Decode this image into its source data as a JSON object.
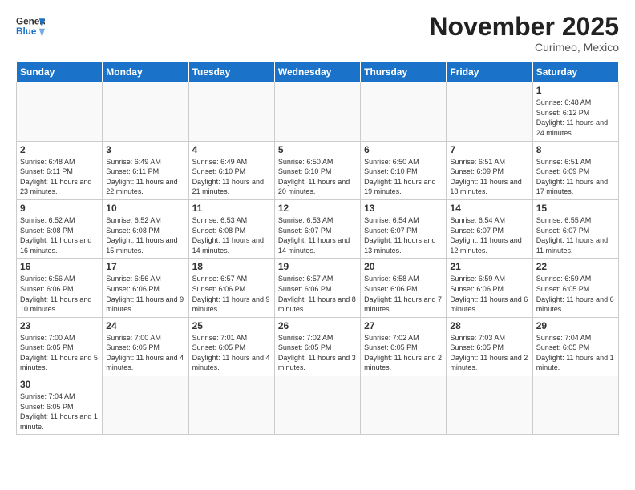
{
  "header": {
    "logo_general": "General",
    "logo_blue": "Blue",
    "month": "November 2025",
    "location": "Curimeo, Mexico"
  },
  "days_of_week": [
    "Sunday",
    "Monday",
    "Tuesday",
    "Wednesday",
    "Thursday",
    "Friday",
    "Saturday"
  ],
  "weeks": [
    [
      {
        "day": "",
        "info": ""
      },
      {
        "day": "",
        "info": ""
      },
      {
        "day": "",
        "info": ""
      },
      {
        "day": "",
        "info": ""
      },
      {
        "day": "",
        "info": ""
      },
      {
        "day": "",
        "info": ""
      },
      {
        "day": "1",
        "info": "Sunrise: 6:48 AM\nSunset: 6:12 PM\nDaylight: 11 hours and 24 minutes."
      }
    ],
    [
      {
        "day": "2",
        "info": "Sunrise: 6:48 AM\nSunset: 6:11 PM\nDaylight: 11 hours and 23 minutes."
      },
      {
        "day": "3",
        "info": "Sunrise: 6:49 AM\nSunset: 6:11 PM\nDaylight: 11 hours and 22 minutes."
      },
      {
        "day": "4",
        "info": "Sunrise: 6:49 AM\nSunset: 6:10 PM\nDaylight: 11 hours and 21 minutes."
      },
      {
        "day": "5",
        "info": "Sunrise: 6:50 AM\nSunset: 6:10 PM\nDaylight: 11 hours and 20 minutes."
      },
      {
        "day": "6",
        "info": "Sunrise: 6:50 AM\nSunset: 6:10 PM\nDaylight: 11 hours and 19 minutes."
      },
      {
        "day": "7",
        "info": "Sunrise: 6:51 AM\nSunset: 6:09 PM\nDaylight: 11 hours and 18 minutes."
      },
      {
        "day": "8",
        "info": "Sunrise: 6:51 AM\nSunset: 6:09 PM\nDaylight: 11 hours and 17 minutes."
      }
    ],
    [
      {
        "day": "9",
        "info": "Sunrise: 6:52 AM\nSunset: 6:08 PM\nDaylight: 11 hours and 16 minutes."
      },
      {
        "day": "10",
        "info": "Sunrise: 6:52 AM\nSunset: 6:08 PM\nDaylight: 11 hours and 15 minutes."
      },
      {
        "day": "11",
        "info": "Sunrise: 6:53 AM\nSunset: 6:08 PM\nDaylight: 11 hours and 14 minutes."
      },
      {
        "day": "12",
        "info": "Sunrise: 6:53 AM\nSunset: 6:07 PM\nDaylight: 11 hours and 14 minutes."
      },
      {
        "day": "13",
        "info": "Sunrise: 6:54 AM\nSunset: 6:07 PM\nDaylight: 11 hours and 13 minutes."
      },
      {
        "day": "14",
        "info": "Sunrise: 6:54 AM\nSunset: 6:07 PM\nDaylight: 11 hours and 12 minutes."
      },
      {
        "day": "15",
        "info": "Sunrise: 6:55 AM\nSunset: 6:07 PM\nDaylight: 11 hours and 11 minutes."
      }
    ],
    [
      {
        "day": "16",
        "info": "Sunrise: 6:56 AM\nSunset: 6:06 PM\nDaylight: 11 hours and 10 minutes."
      },
      {
        "day": "17",
        "info": "Sunrise: 6:56 AM\nSunset: 6:06 PM\nDaylight: 11 hours and 9 minutes."
      },
      {
        "day": "18",
        "info": "Sunrise: 6:57 AM\nSunset: 6:06 PM\nDaylight: 11 hours and 9 minutes."
      },
      {
        "day": "19",
        "info": "Sunrise: 6:57 AM\nSunset: 6:06 PM\nDaylight: 11 hours and 8 minutes."
      },
      {
        "day": "20",
        "info": "Sunrise: 6:58 AM\nSunset: 6:06 PM\nDaylight: 11 hours and 7 minutes."
      },
      {
        "day": "21",
        "info": "Sunrise: 6:59 AM\nSunset: 6:06 PM\nDaylight: 11 hours and 6 minutes."
      },
      {
        "day": "22",
        "info": "Sunrise: 6:59 AM\nSunset: 6:05 PM\nDaylight: 11 hours and 6 minutes."
      }
    ],
    [
      {
        "day": "23",
        "info": "Sunrise: 7:00 AM\nSunset: 6:05 PM\nDaylight: 11 hours and 5 minutes."
      },
      {
        "day": "24",
        "info": "Sunrise: 7:00 AM\nSunset: 6:05 PM\nDaylight: 11 hours and 4 minutes."
      },
      {
        "day": "25",
        "info": "Sunrise: 7:01 AM\nSunset: 6:05 PM\nDaylight: 11 hours and 4 minutes."
      },
      {
        "day": "26",
        "info": "Sunrise: 7:02 AM\nSunset: 6:05 PM\nDaylight: 11 hours and 3 minutes."
      },
      {
        "day": "27",
        "info": "Sunrise: 7:02 AM\nSunset: 6:05 PM\nDaylight: 11 hours and 2 minutes."
      },
      {
        "day": "28",
        "info": "Sunrise: 7:03 AM\nSunset: 6:05 PM\nDaylight: 11 hours and 2 minutes."
      },
      {
        "day": "29",
        "info": "Sunrise: 7:04 AM\nSunset: 6:05 PM\nDaylight: 11 hours and 1 minute."
      }
    ],
    [
      {
        "day": "30",
        "info": "Sunrise: 7:04 AM\nSunset: 6:05 PM\nDaylight: 11 hours and 1 minute."
      },
      {
        "day": "",
        "info": ""
      },
      {
        "day": "",
        "info": ""
      },
      {
        "day": "",
        "info": ""
      },
      {
        "day": "",
        "info": ""
      },
      {
        "day": "",
        "info": ""
      },
      {
        "day": "",
        "info": ""
      }
    ]
  ]
}
